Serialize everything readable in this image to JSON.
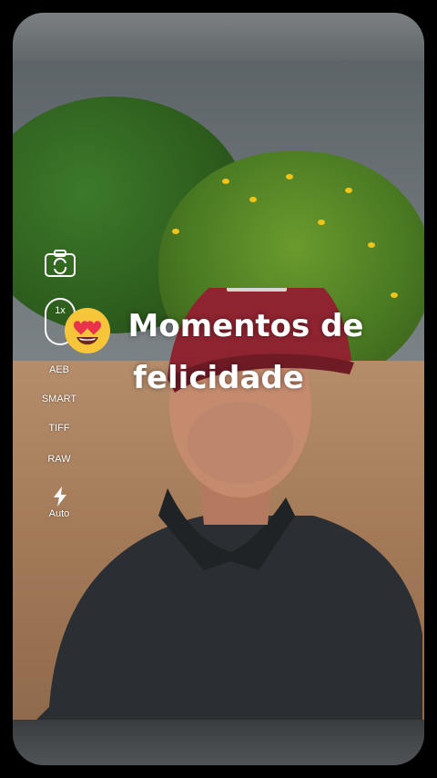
{
  "camera_ui": {
    "zoom_label": "1x",
    "modes": [
      "AEB",
      "SMART",
      "TIFF",
      "RAW"
    ],
    "flash_label": "Auto"
  },
  "caption": {
    "line1": "Momentos de",
    "line2": "felicidade"
  },
  "icons": {
    "camera_switch": "camera-rotate-icon",
    "flash": "lightning-bolt-icon",
    "emoji": "heart-eyes-emoji-icon"
  }
}
